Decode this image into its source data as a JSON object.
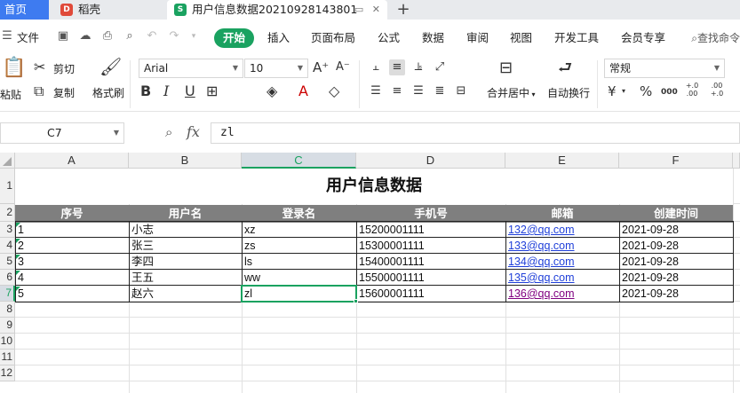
{
  "tabs": {
    "home": "首页",
    "docer": "稻壳",
    "file": "用户信息数据20210928143801",
    "add": "+"
  },
  "menu": {
    "file": "文件",
    "items": [
      "开始",
      "插入",
      "页面布局",
      "公式",
      "数据",
      "审阅",
      "视图",
      "开发工具",
      "会员专享"
    ],
    "search": "查找命令"
  },
  "ribbon": {
    "paste": "粘贴",
    "cut": "剪切",
    "copy": "复制",
    "format_painter": "格式刷",
    "font_name": "Arial",
    "font_size": "10",
    "merge_center": "合并居中",
    "wrap_text": "自动换行",
    "number_format": "常规",
    "currency": "¥",
    "percent": "%",
    "thousands": "000",
    "inc_decimal": "+.0 .00",
    "dec_decimal": ".00 +.0"
  },
  "formula_bar": {
    "cell_ref": "C7",
    "fx": "fx",
    "content": "zl"
  },
  "sheet": {
    "columns": [
      "A",
      "B",
      "C",
      "D",
      "E",
      "F"
    ],
    "rows": [
      "1",
      "2",
      "3",
      "4",
      "5",
      "6",
      "7",
      "8",
      "9",
      "10",
      "11",
      "12"
    ],
    "active_column": "C",
    "active_row": "7",
    "title": "用户信息数据",
    "headers": [
      "序号",
      "用户名",
      "登录名",
      "手机号",
      "邮箱",
      "创建时间"
    ],
    "data": [
      [
        "1",
        "小志",
        "xz",
        "15200001111",
        "132@qq.com",
        "2021-09-28"
      ],
      [
        "2",
        "张三",
        "zs",
        "15300001111",
        "133@qq.com",
        "2021-09-28"
      ],
      [
        "3",
        "李四",
        "ls",
        "15400001111",
        "134@qq.com",
        "2021-09-28"
      ],
      [
        "4",
        "王五",
        "ww",
        "15500001111",
        "135@qq.com",
        "2021-09-28"
      ],
      [
        "5",
        "赵六",
        "zl",
        "15600001111",
        "136@qq.com",
        "2021-09-28"
      ]
    ],
    "colors": {
      "header_bg": "#7f7f7f",
      "accent": "#1aa260",
      "link": "#1f3fd9",
      "link_visited": "#800080"
    }
  }
}
